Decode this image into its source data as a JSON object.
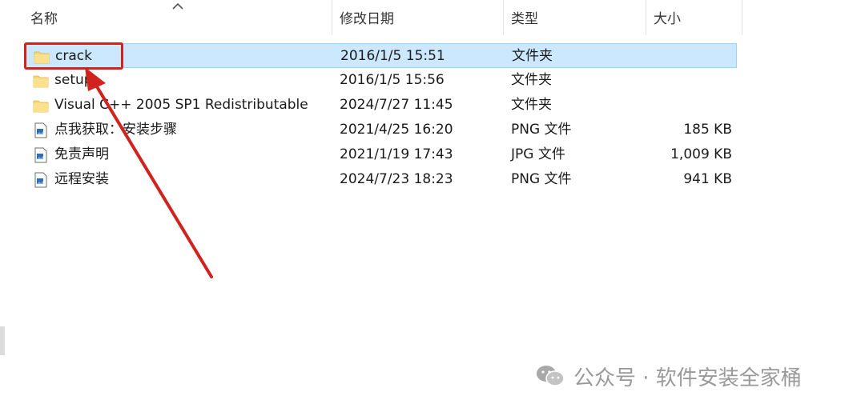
{
  "columns": {
    "name": "名称",
    "modified": "修改日期",
    "type": "类型",
    "size": "大小"
  },
  "files": [
    {
      "name": "crack",
      "modified": "2016/1/5 15:51",
      "type": "文件夹",
      "size": "",
      "icon": "folder-icon",
      "selected": true
    },
    {
      "name": "setup",
      "modified": "2016/1/5 15:56",
      "type": "文件夹",
      "size": "",
      "icon": "folder-icon",
      "selected": false
    },
    {
      "name": "Visual C++ 2005 SP1 Redistributable",
      "modified": "2024/7/27 11:45",
      "type": "文件夹",
      "size": "",
      "icon": "folder-icon",
      "selected": false
    },
    {
      "name": "点我获取：安装步骤",
      "modified": "2021/4/25 16:20",
      "type": "PNG 文件",
      "size": "185 KB",
      "icon": "image-file-icon",
      "selected": false
    },
    {
      "name": "免责声明",
      "modified": "2021/1/19 17:43",
      "type": "JPG 文件",
      "size": "1,009 KB",
      "icon": "image-file-icon",
      "selected": false
    },
    {
      "name": "远程安装",
      "modified": "2024/7/23 18:23",
      "type": "PNG 文件",
      "size": "941 KB",
      "icon": "image-file-icon",
      "selected": false
    }
  ],
  "watermark": {
    "text": "公众号 · 软件安装全家桶",
    "icon": "wechat-icon"
  },
  "colors": {
    "selection": "#cce8ff",
    "highlight": "#d0231e",
    "folder": "#f8d775"
  }
}
